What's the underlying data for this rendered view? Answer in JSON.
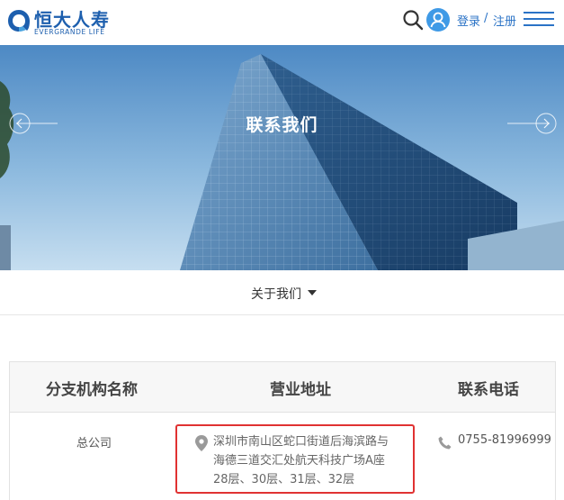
{
  "header": {
    "logo_cn": "恒大人寿",
    "logo_en": "EVERGRANDE LIFE",
    "login": "登录",
    "separator": "/",
    "register": "注册"
  },
  "banner": {
    "title": "联系我们"
  },
  "subnav": {
    "label": "关于我们"
  },
  "table": {
    "headers": [
      "分支机构名称",
      "营业地址",
      "联系电话"
    ],
    "rows": [
      {
        "name": "总公司",
        "address_lines": [
          "深圳市南山区蛇口街道后海滨路与",
          "海德三道交汇处航天科技广场A座",
          "28层、30层、31层、32层"
        ],
        "phone": "0755-81996999"
      }
    ]
  },
  "icons": {
    "search": "search-icon",
    "user": "user-icon",
    "menu": "menu-icon",
    "prev": "arrow-left-icon",
    "next": "arrow-right-icon",
    "dropdown": "caret-down-icon",
    "location": "location-pin-icon",
    "phone": "phone-icon"
  },
  "colors": {
    "brand": "#1d5fae",
    "link": "#2b73c6",
    "highlight_border": "#e03232"
  }
}
